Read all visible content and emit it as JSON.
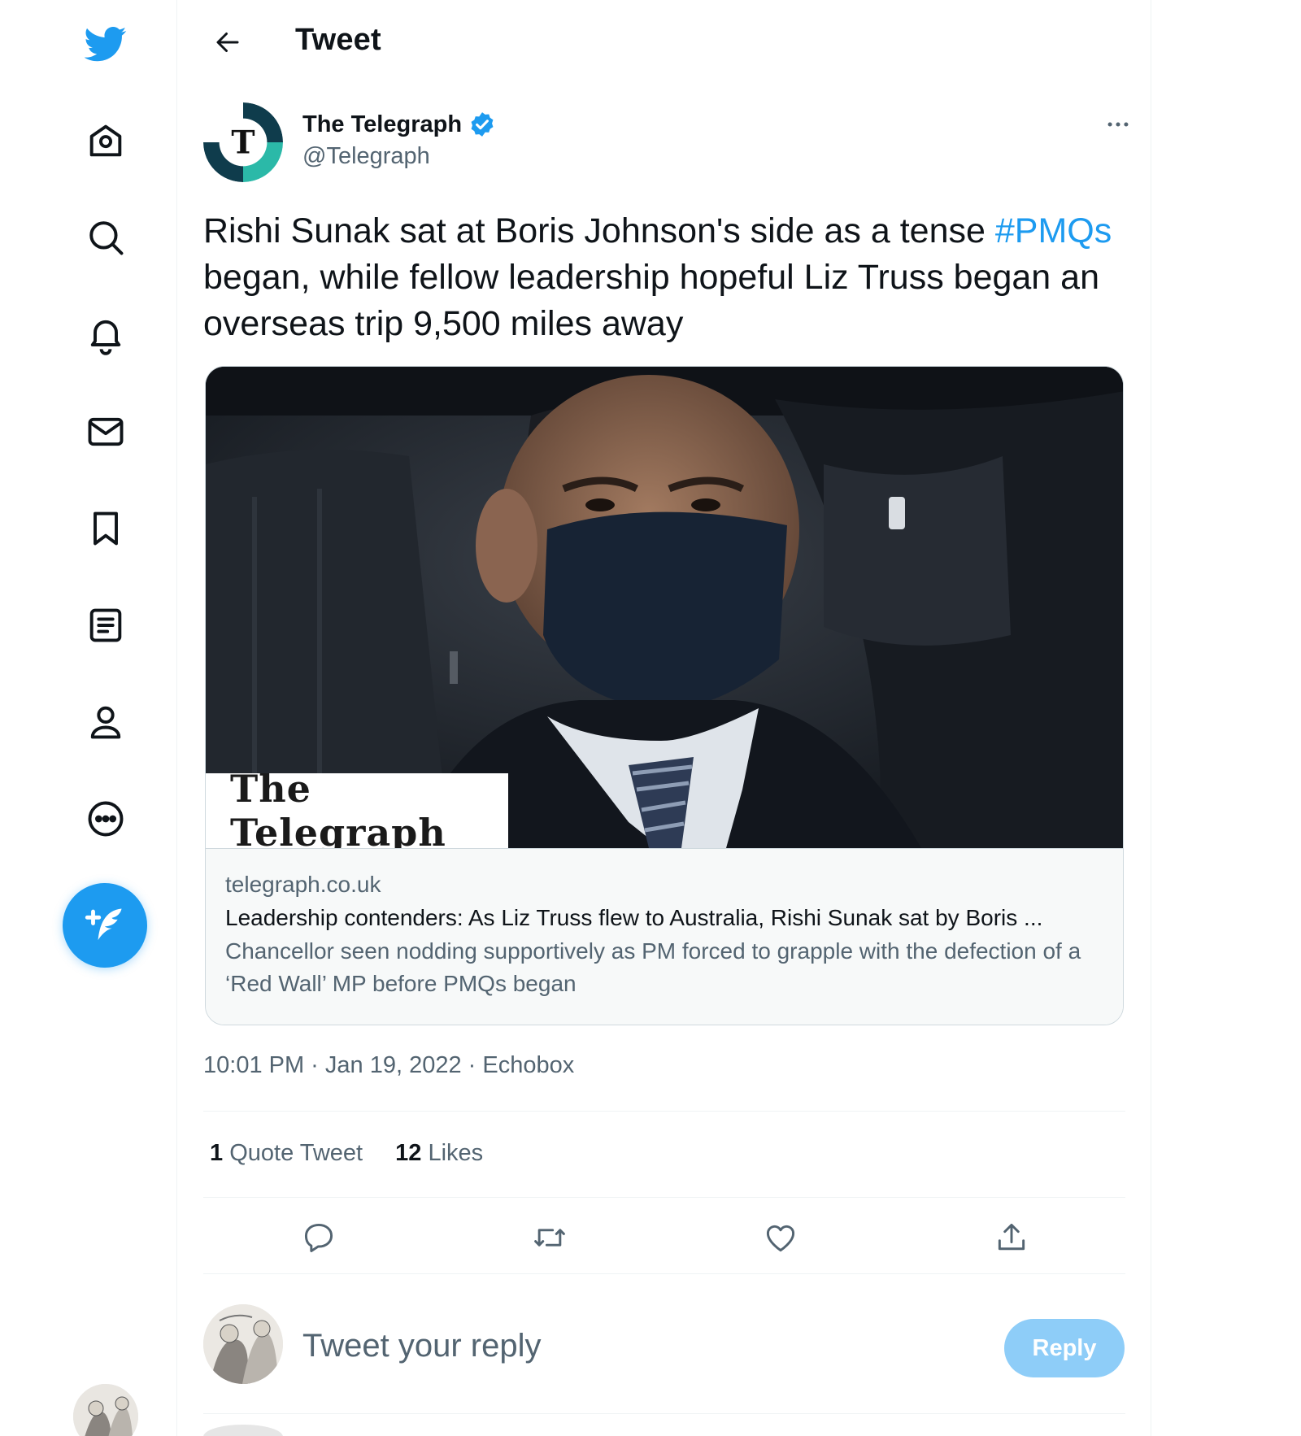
{
  "header": {
    "title": "Tweet"
  },
  "nav": {
    "items": [
      {
        "name": "home",
        "icon": "home-icon"
      },
      {
        "name": "explore",
        "icon": "search-icon"
      },
      {
        "name": "notifications",
        "icon": "bell-icon"
      },
      {
        "name": "messages",
        "icon": "mail-icon"
      },
      {
        "name": "bookmarks",
        "icon": "bookmark-icon"
      },
      {
        "name": "lists",
        "icon": "list-icon"
      },
      {
        "name": "profile",
        "icon": "person-icon"
      },
      {
        "name": "more",
        "icon": "more-circle-icon"
      }
    ],
    "compose_icon": "compose-feather-icon"
  },
  "tweet": {
    "author_name": "The Telegraph",
    "author_handle": "@Telegraph",
    "verified": true,
    "text_before": "Rishi Sunak sat at Boris Johnson's side as a tense ",
    "hashtag": "#PMQs",
    "text_after": " began, while fellow leadership hopeful Liz Truss began an overseas trip 9,500 miles away",
    "card": {
      "image_brand": "The Telegraph",
      "domain": "telegraph.co.uk",
      "title": "Leadership contenders: As Liz Truss flew to Australia, Rishi Sunak sat by Boris ...",
      "description": "Chancellor seen nodding supportively as PM forced to grapple with the defection of a ‘Red Wall’ MP before PMQs began"
    },
    "timestamp": "10:01 PM · Jan 19, 2022 · Echobox",
    "stats": {
      "quote_count": "1",
      "quote_label": "Quote Tweet",
      "like_count": "12",
      "like_label": "Likes"
    },
    "actions": [
      "reply-icon",
      "retweet-icon",
      "like-icon",
      "share-icon"
    ]
  },
  "reply": {
    "placeholder": "Tweet your reply",
    "button_label": "Reply"
  },
  "colors": {
    "accent": "#1d9bf0",
    "reply_button_disabled": "#8ecdf8",
    "secondary_text": "#536471",
    "border": "#eff3f4"
  }
}
